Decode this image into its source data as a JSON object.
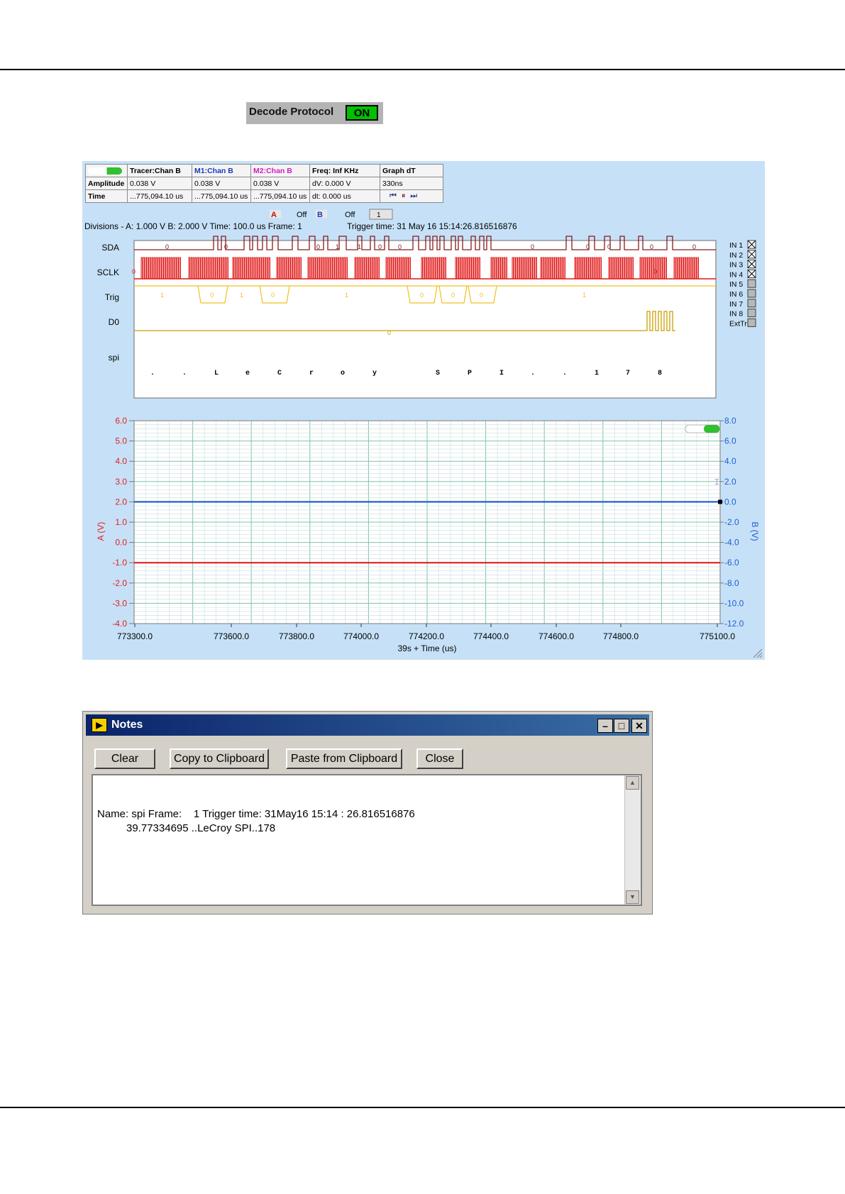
{
  "decode": {
    "label": "Decode Protocol",
    "state": "ON"
  },
  "info_table": {
    "headers": [
      "Tracer:Chan B",
      "M1:Chan B",
      "M2:Chan B",
      "Freq: Inf KHz",
      "Graph dT"
    ],
    "amplitude_label": "Amplitude",
    "amplitude": [
      "0.038 V",
      "0.038 V",
      "0.038 V",
      "dV: 0.000 V",
      "330ns"
    ],
    "time_label": "Time",
    "time": [
      "...775,094.10 us",
      "...775,094.10 us",
      "...775,094.10 us",
      "dt:  0.000 us"
    ]
  },
  "cursor_controls": {
    "a_label": "A",
    "a_state": "Off",
    "b_label": "B",
    "b_state": "Off",
    "frame_value": "1"
  },
  "status_line": {
    "divisions": "Divisions -  A: 1.000 V    B: 2.000 V    Time: 100.0 us  Frame: 1",
    "trigger": "Trigger time: 31 May 16 15:14:26.816516876"
  },
  "logic": {
    "channel_labels": [
      "SDA",
      "SCLK",
      "Trig",
      "D0",
      "spi"
    ],
    "sda_values": [
      "0",
      "0",
      "0",
      "1",
      "1",
      "0",
      "0",
      "0",
      "0",
      "0",
      "0",
      "0"
    ],
    "sclk_values": [
      "0",
      "0"
    ],
    "trig_values": [
      "1",
      "0",
      "1",
      "0",
      "1",
      "0",
      "0",
      "0",
      "1"
    ],
    "d0_values": [
      "0"
    ],
    "spi_chars": [
      ".",
      ".",
      "L",
      "e",
      "C",
      "r",
      "o",
      "y",
      "S",
      "P",
      "I",
      ".",
      ".",
      "1",
      "7",
      "8"
    ],
    "input_labels": [
      "IN 1",
      "IN 2",
      "IN 3",
      "IN 4",
      "IN 5",
      "IN 6",
      "IN 7",
      "IN 8",
      "ExtTri"
    ],
    "input_checked": [
      true,
      true,
      true,
      true,
      false,
      false,
      false,
      false,
      false
    ]
  },
  "chart_data": {
    "type": "line",
    "xlabel": "39s + Time (us)",
    "x_ticks": [
      "773300.0",
      "773600.0",
      "773800.0",
      "774000.0",
      "774200.0",
      "774400.0",
      "774600.0",
      "774800.0",
      "775100.0"
    ],
    "xlim": [
      773300,
      775100
    ],
    "ylabel_left": "A (V)",
    "ylim_left": [
      -4,
      6
    ],
    "y_ticks_left": [
      "6.0",
      "5.0",
      "4.0",
      "3.0",
      "2.0",
      "1.0",
      "0.0",
      "-1.0",
      "-2.0",
      "-3.0",
      "-4.0"
    ],
    "ylabel_right": "B (V)",
    "ylim_right": [
      -12,
      8
    ],
    "y_ticks_right": [
      "8.0",
      "6.0",
      "4.0",
      "2.0",
      "0.0",
      "-2.0",
      "-4.0",
      "-6.0",
      "-8.0",
      "-10.0",
      "-12.0"
    ],
    "grid": true,
    "series": [
      {
        "axis": "left",
        "color": "#e02020",
        "x": [
          773300,
          775100
        ],
        "y": [
          -1.0,
          -1.0
        ]
      },
      {
        "axis": "right",
        "color": "#2060d0",
        "x": [
          773300,
          775100
        ],
        "y": [
          0.0,
          0.0
        ]
      }
    ]
  },
  "notes": {
    "title": "Notes",
    "buttons": [
      "Clear",
      "Copy to Clipboard",
      "Paste from Clipboard",
      "Close"
    ],
    "line1": "Name: spi Frame:    1 Trigger time: 31May16 15:14 : 26.816516876",
    "line2": "39.77334695 ..LeCroy SPI..178"
  },
  "colors": {
    "sda": "#8b1a1a",
    "sclk": "#e01818",
    "trig": "#f0c020",
    "d0": "#c8a000",
    "scope_bg": "#c6e1f7",
    "toggle_on": "#00c000"
  }
}
